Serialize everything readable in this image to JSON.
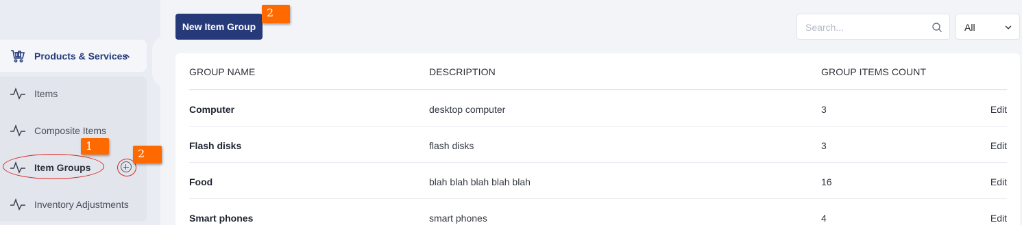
{
  "sidebar": {
    "group": {
      "label": "Products & Services",
      "icon": "cart-icon",
      "expanded": true
    },
    "items": [
      {
        "label": "Items",
        "icon": "activity-icon",
        "active": false
      },
      {
        "label": "Composite Items",
        "icon": "activity-icon",
        "active": false
      },
      {
        "label": "Item Groups",
        "icon": "activity-icon",
        "active": true
      },
      {
        "label": "Inventory Adjustments",
        "icon": "activity-icon",
        "active": false
      }
    ],
    "add_icon": "plus-circle-icon"
  },
  "toolbar": {
    "new_button_label": "New Item Group",
    "search_placeholder": "Search...",
    "filter_value": "All"
  },
  "annotations": {
    "badge_1": "1",
    "badge_2_sidebar": "2",
    "badge_2_button": "2",
    "annotation_color": "#ff6a00",
    "circle_color": "#e01f1f"
  },
  "table": {
    "headers": [
      "GROUP NAME",
      "DESCRIPTION",
      "GROUP ITEMS COUNT"
    ],
    "rows": [
      {
        "name": "Computer",
        "description": "desktop computer",
        "count": "3",
        "action": "Edit"
      },
      {
        "name": "Flash disks",
        "description": "flash disks",
        "count": "3",
        "action": "Edit"
      },
      {
        "name": "Food",
        "description": "blah blah blah blah blah",
        "count": "16",
        "action": "Edit"
      },
      {
        "name": "Smart phones",
        "description": "smart phones",
        "count": "4",
        "action": "Edit"
      }
    ]
  },
  "colors": {
    "brand": "#263a7a",
    "background": "#f2f4f8"
  }
}
